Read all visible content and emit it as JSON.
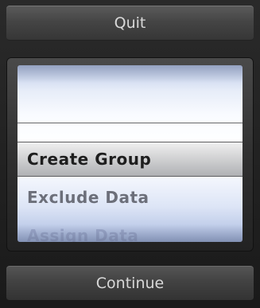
{
  "buttons": {
    "quit": "Quit",
    "continue": "Continue"
  },
  "picker": {
    "items": [
      "Create Group",
      "Exclude Data",
      "Assign Data"
    ],
    "selected": "Create Group"
  }
}
